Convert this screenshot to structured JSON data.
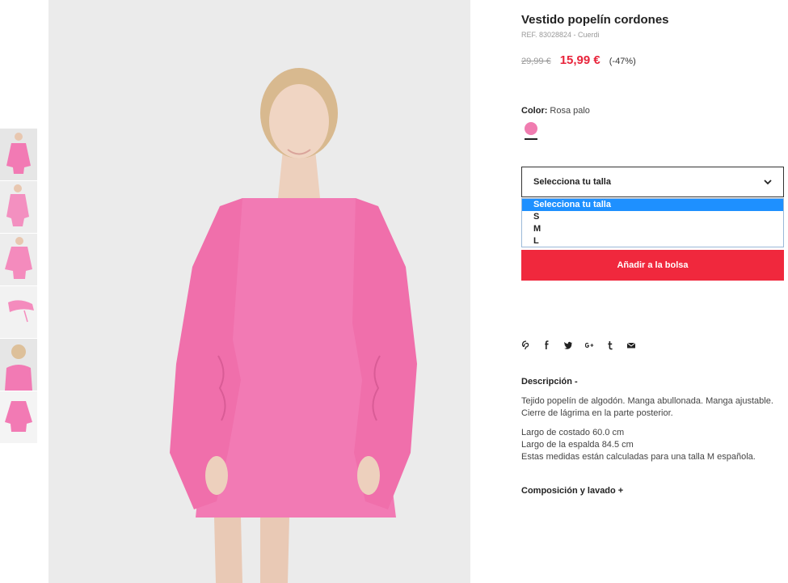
{
  "product": {
    "title": "Vestido popelín cordones",
    "ref": "REF. 83028824 - Cuerdi",
    "old_price": "29,99 €",
    "new_price": "15,99 €",
    "discount": "(-47%)"
  },
  "color": {
    "label": "Color:",
    "value": "Rosa palo",
    "swatch_hex": "#f07cb0"
  },
  "size": {
    "selected": "Selecciona tu talla",
    "options": [
      "Selecciona tu talla",
      "S",
      "M",
      "L"
    ]
  },
  "add_to_bag": "Añadir a la bolsa",
  "share_icons": [
    "pinterest-icon",
    "facebook-icon",
    "twitter-icon",
    "google-plus-icon",
    "tumblr-icon",
    "email-icon"
  ],
  "description": {
    "heading": "Descripción -",
    "paragraph1": "Tejido popelín de algodón. Manga abullonada. Manga ajustable. Cierre de lágrima en la parte posterior.",
    "line1": "Largo de costado 60.0 cm",
    "line2": "Largo de la espalda 84.5 cm",
    "line3": "Estas medidas están calculadas para una talla M española."
  },
  "composition_heading": "Composición y lavado +",
  "colors": {
    "accent_red": "#f0283d",
    "price_red": "#e8243b",
    "dress_pink": "#f27ab4",
    "select_highlight": "#1e90ff"
  }
}
